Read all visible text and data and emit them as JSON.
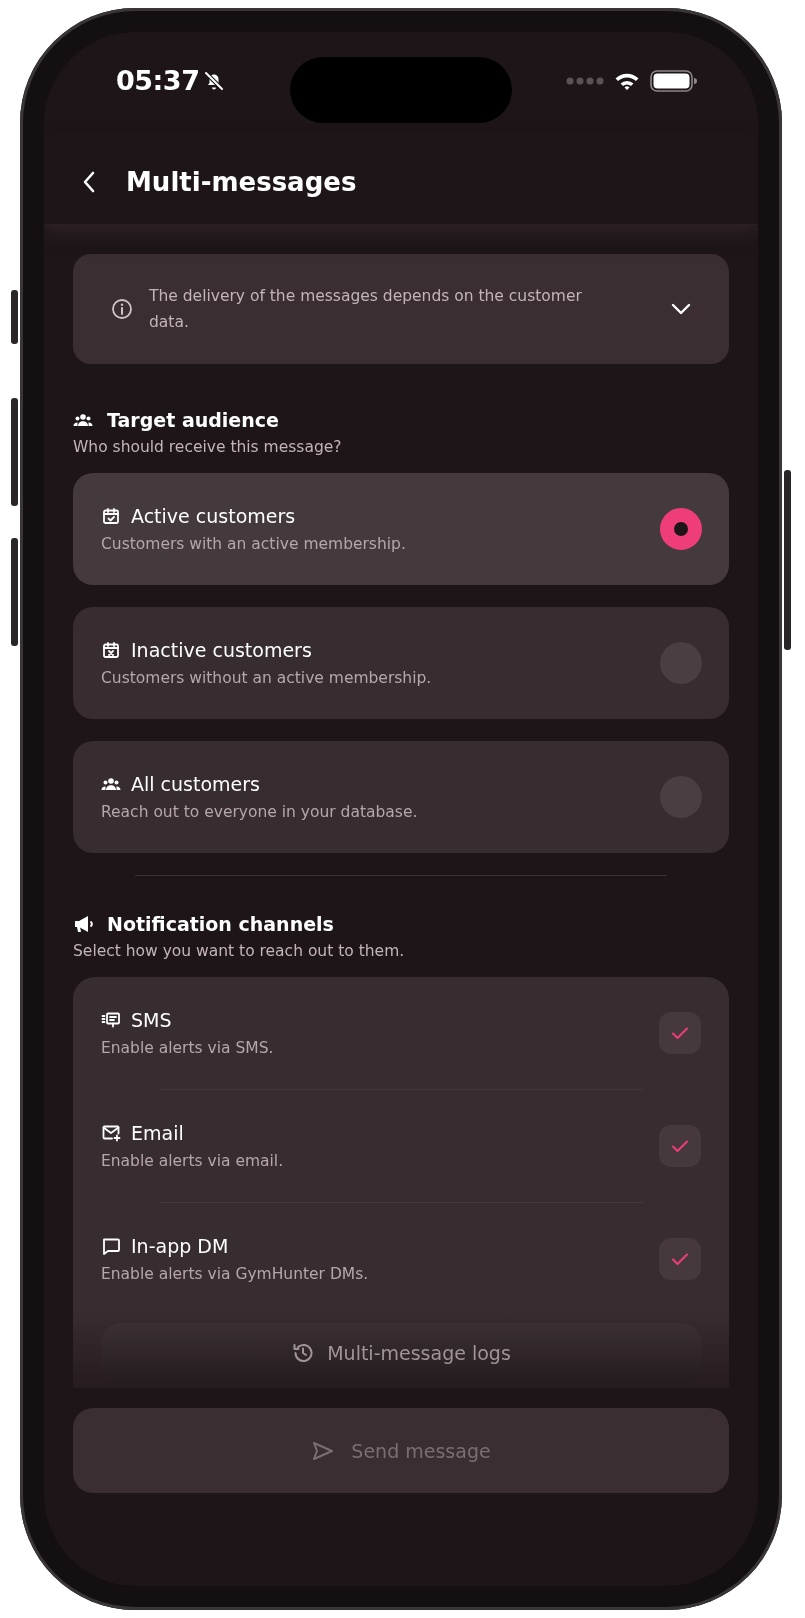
{
  "status_bar": {
    "time": "05:37",
    "silent": true
  },
  "header": {
    "title": "Multi-messages"
  },
  "info": {
    "text": "The delivery of the messages depends on the customer data.",
    "expanded": false
  },
  "audience": {
    "title": "Target audience",
    "subtitle": "Who should receive this message?",
    "options": [
      {
        "kind": "calendar-check",
        "title": "Active customers",
        "description": "Customers with an active membership.",
        "selected": true
      },
      {
        "kind": "calendar-x",
        "title": "Inactive customers",
        "description": "Customers without an active membership.",
        "selected": false
      },
      {
        "kind": "people",
        "title": "All customers",
        "description": "Reach out to everyone in your database.",
        "selected": false
      }
    ]
  },
  "channels": {
    "title": "Notification channels",
    "subtitle": "Select how you want to reach out to them.",
    "items": [
      {
        "kind": "sms",
        "title": "SMS",
        "description": "Enable alerts via SMS.",
        "checked": true
      },
      {
        "kind": "email",
        "title": "Email",
        "description": "Enable alerts via email.",
        "checked": true
      },
      {
        "kind": "chat",
        "title": "In-app DM",
        "description": "Enable alerts via GymHunter DMs.",
        "checked": true
      }
    ]
  },
  "logs_button": {
    "label": "Multi-message logs"
  },
  "send_button": {
    "label": "Send message",
    "disabled": true
  }
}
